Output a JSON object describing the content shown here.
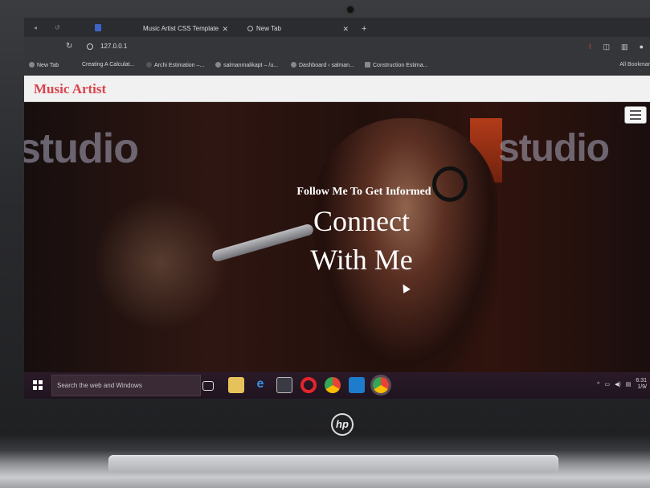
{
  "browser": {
    "tabs": [
      {
        "label": "Music Artist CSS Template",
        "active": true
      },
      {
        "label": "New Tab",
        "active": false
      }
    ],
    "url": "127.0.0.1",
    "bookmarks": [
      "New Tab",
      "Creating A Calculat...",
      "Archi Estimation –...",
      "salmanmalikapt – /u...",
      "Dashboard ‹ salman...",
      "Construction Estima..."
    ],
    "all_bookmarks_label": "All Bookmar"
  },
  "site": {
    "logo": "Music Artist",
    "hero": {
      "background_words": [
        "studio",
        "studio"
      ],
      "tagline": "Follow Me To Get Informed",
      "headline_line1": "Connect",
      "headline_line2": "With Me"
    }
  },
  "taskbar": {
    "search_placeholder": "Search the web and Windows",
    "clock_time": "6:31",
    "clock_date": "1/9/"
  },
  "device": {
    "brand": "hp"
  },
  "colors": {
    "logo": "#d9434d",
    "header_bg": "#f1f1f1",
    "taskbar_bg": "#2b1a28",
    "browser_chrome": "#35363a"
  }
}
